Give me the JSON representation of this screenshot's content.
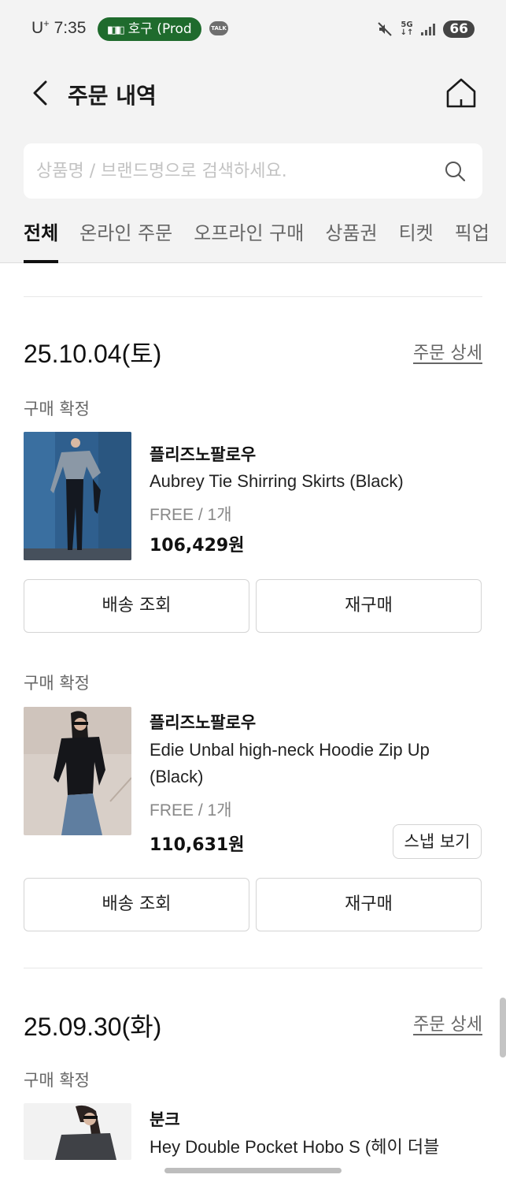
{
  "status_bar": {
    "carrier": "U",
    "carrier_sup": "+",
    "time": "7:35",
    "call_pill": "호구 (Prod",
    "talk_badge": "TALK",
    "network": "5G",
    "battery": "66"
  },
  "header": {
    "title": "주문 내역"
  },
  "search": {
    "placeholder": "상품명 / 브랜드명으로 검색하세요.",
    "value": ""
  },
  "tabs": [
    {
      "label": "전체",
      "active": true
    },
    {
      "label": "온라인 주문",
      "active": false
    },
    {
      "label": "오프라인 구매",
      "active": false
    },
    {
      "label": "상품권",
      "active": false
    },
    {
      "label": "티켓",
      "active": false
    },
    {
      "label": "픽업",
      "active": false
    }
  ],
  "orders": [
    {
      "date": "25.10.04(토)",
      "detail_link": "주문 상세",
      "items": [
        {
          "status": "구매 확정",
          "brand": "플리즈노팔로우",
          "name": "Aubrey Tie Shirring Skirts (Black)",
          "option": "FREE / 1개",
          "price": "106,429원",
          "buttons": [
            "배송 조회",
            "재구매"
          ]
        },
        {
          "status": "구매 확정",
          "brand": "플리즈노팔로우",
          "name": "Edie Unbal high-neck Hoodie Zip Up (Black)",
          "option": "FREE / 1개",
          "price": "110,631원",
          "snap_button": "스냅 보기",
          "buttons": [
            "배송 조회",
            "재구매"
          ]
        }
      ]
    },
    {
      "date": "25.09.30(화)",
      "detail_link": "주문 상세",
      "items": [
        {
          "status": "구매 확정",
          "brand": "분크",
          "name": "Hey Double Pocket Hobo S (헤이 더블"
        }
      ]
    }
  ],
  "colors": {
    "header_bg": "#f3f3f3",
    "call_pill": "#1f6b2d",
    "text_primary": "#111111",
    "text_secondary": "#666666"
  }
}
